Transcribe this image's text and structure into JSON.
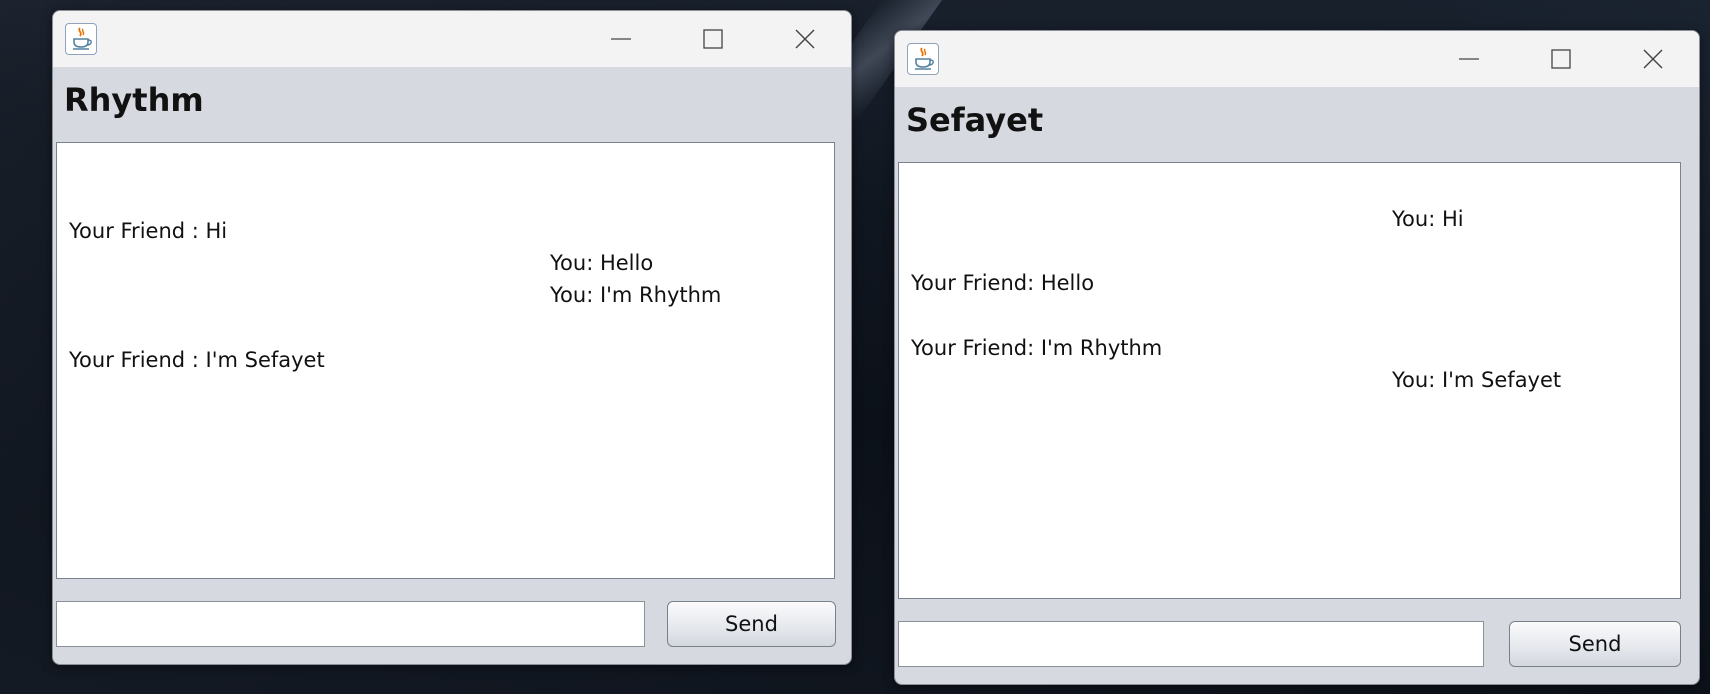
{
  "windows": [
    {
      "name": "Rhythm",
      "window_buttons": {
        "minimize": "—",
        "maximize": "☐",
        "close": "✕"
      },
      "messages": [
        {
          "sender": "friend",
          "text": "Your Friend : Hi"
        },
        {
          "sender": "you",
          "text": "You: Hello"
        },
        {
          "sender": "you",
          "text": "You: I'm Rhythm"
        },
        {
          "sender": "friend",
          "text": "Your Friend : I'm Sefayet"
        }
      ],
      "input": {
        "value": "",
        "placeholder": ""
      },
      "send_label": "Send"
    },
    {
      "name": "Sefayet",
      "window_buttons": {
        "minimize": "—",
        "maximize": "☐",
        "close": "✕"
      },
      "messages": [
        {
          "sender": "you",
          "text": "You: Hi"
        },
        {
          "sender": "friend",
          "text": "Your Friend: Hello"
        },
        {
          "sender": "friend",
          "text": "Your Friend: I'm Rhythm"
        },
        {
          "sender": "you",
          "text": "You: I'm Sefayet"
        }
      ],
      "input": {
        "value": "",
        "placeholder": ""
      },
      "send_label": "Send"
    }
  ],
  "icons": {
    "app_icon": "java-coffee-cup-icon",
    "minimize": "minimize-icon",
    "maximize": "maximize-icon",
    "close": "close-icon"
  },
  "colors": {
    "window_body": "#d6d9e0",
    "titlebar": "#f3f3f3",
    "chat_background": "#ffffff",
    "text": "#111111"
  }
}
